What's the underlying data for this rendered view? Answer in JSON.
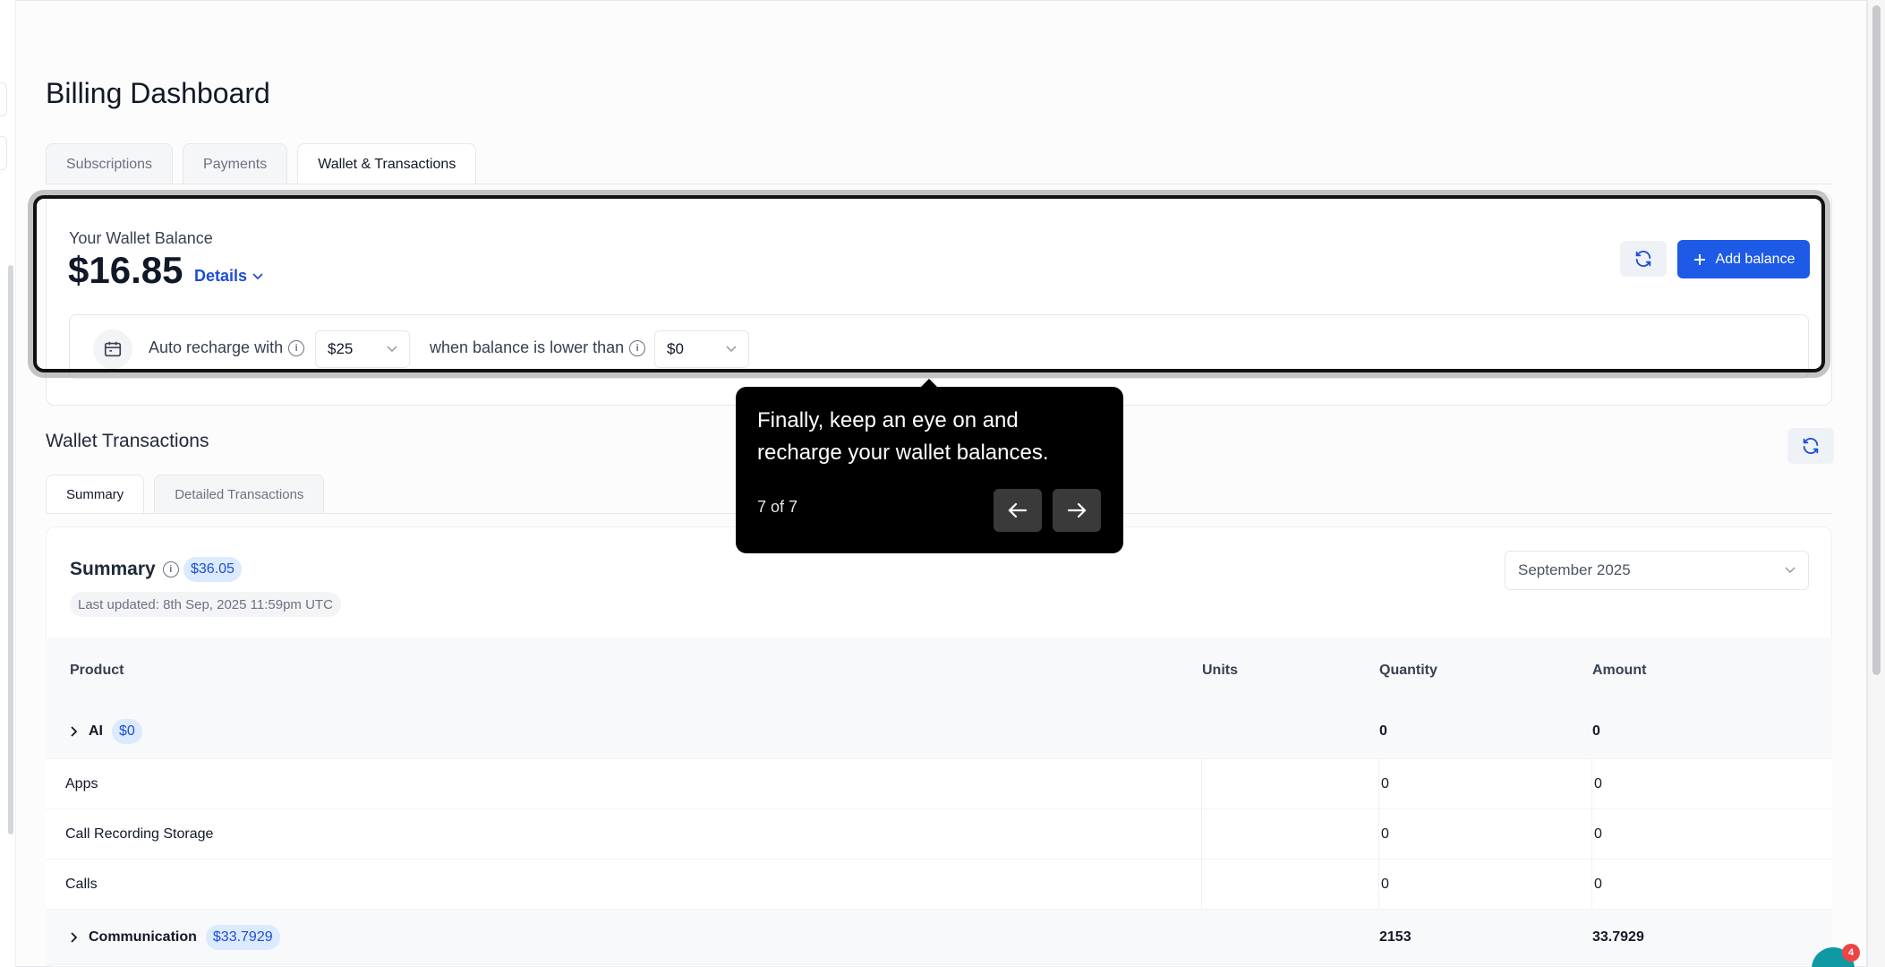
{
  "page": {
    "title": "Billing Dashboard"
  },
  "tabs": [
    {
      "label": "Subscriptions"
    },
    {
      "label": "Payments"
    },
    {
      "label": "Wallet & Transactions"
    }
  ],
  "wallet": {
    "label": "Your Wallet Balance",
    "amount": "$16.85",
    "details_label": "Details",
    "add_balance_label": "Add balance",
    "auto_recharge_label": "Auto recharge with",
    "auto_recharge_value": "$25",
    "threshold_label": "when balance is lower than",
    "threshold_value": "$0"
  },
  "tour": {
    "message": "Finally, keep an eye on and recharge your wallet balances.",
    "step": "7 of 7"
  },
  "transactions": {
    "title": "Wallet Transactions",
    "tabs": [
      {
        "label": "Summary"
      },
      {
        "label": "Detailed Transactions"
      }
    ],
    "summary": {
      "title": "Summary",
      "total_badge": "$36.05",
      "last_updated": "Last updated: 8th Sep, 2025 11:59pm UTC",
      "month": "September 2025"
    },
    "table": {
      "columns": [
        "Product",
        "Units",
        "Quantity",
        "Amount"
      ],
      "rows": [
        {
          "type": "group",
          "name": "AI",
          "badge": "$0",
          "units": "",
          "quantity": "0",
          "amount": "0"
        },
        {
          "type": "item",
          "name": "Apps",
          "units": "",
          "quantity": "0",
          "amount": "0"
        },
        {
          "type": "item",
          "name": "Call Recording Storage",
          "units": "",
          "quantity": "0",
          "amount": "0"
        },
        {
          "type": "item",
          "name": "Calls",
          "units": "",
          "quantity": "0",
          "amount": "0"
        },
        {
          "type": "group",
          "name": "Communication",
          "badge": "$33.7929",
          "units": "",
          "quantity": "2153",
          "amount": "33.7929"
        }
      ]
    }
  },
  "chat": {
    "count": "4"
  },
  "colors": {
    "primary": "#1d5ae6",
    "badge_bg": "#dbeafe",
    "badge_text": "#1d4ed8",
    "tooltip_bg": "#000000"
  }
}
